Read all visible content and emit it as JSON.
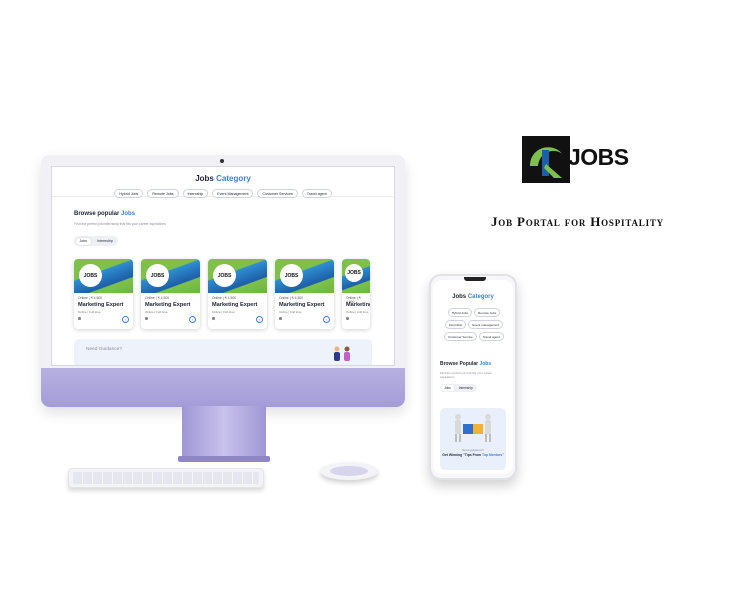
{
  "brand": {
    "logo_text": "JOBS",
    "tagline": "Job Portal for Hospitality"
  },
  "desktop": {
    "title_plain": "Jobs",
    "title_accent": "Category",
    "categories": [
      "Hybrid Jobs",
      "Remote Jobs",
      "Internship",
      "Event Management",
      "Customer Services",
      "Travel agent"
    ],
    "browse_plain": "Browse popular",
    "browse_accent": "Jobs",
    "browse_sub": "Find the perfect job/internship that fits your career aspirations",
    "toggle": [
      "Jobs",
      "Internship"
    ],
    "cards": [
      {
        "logo": "JOBS",
        "meta": "Online | ₹ 4,500",
        "role": "Marketing Expert",
        "loc": "Online | Full time"
      },
      {
        "logo": "JOBS",
        "meta": "Online | ₹ 4,500",
        "role": "Marketing Expert",
        "loc": "Online | Full time"
      },
      {
        "logo": "JOBS",
        "meta": "Online | ₹ 4,500",
        "role": "Marketing Expert",
        "loc": "Online | Full time"
      },
      {
        "logo": "JOBS",
        "meta": "Online | ₹ 4,500",
        "role": "Marketing Expert",
        "loc": "Online | Full time"
      },
      {
        "logo": "JOBS",
        "meta": "Online | ₹ 4,500",
        "role": "Marketing",
        "loc": "Online | Full time"
      }
    ],
    "guidance_text": "Need Guidance?"
  },
  "mobile": {
    "title_plain": "Jobs",
    "title_accent": "Category",
    "categories": [
      "Hybrid Jobs",
      "Remote Jobs",
      "Internship",
      "Event management",
      "Customer Service",
      "Travel agent"
    ],
    "browse_plain": "Browse Popular",
    "browse_accent": "Jobs",
    "browse_sub": "Find the perfect job that fits your career aspirations",
    "toggle": [
      "Jobs",
      "Internship"
    ],
    "banner_line1": "Need guidance?",
    "banner_line2_plain": "Get Winning \"Tips From",
    "banner_line2_accent": "Top Mentors\""
  },
  "colors": {
    "accent": "#3f7fd6",
    "imac_purple": "#a49cd8",
    "logo_green": "#7ec14a",
    "logo_blue": "#1d5ea8"
  }
}
